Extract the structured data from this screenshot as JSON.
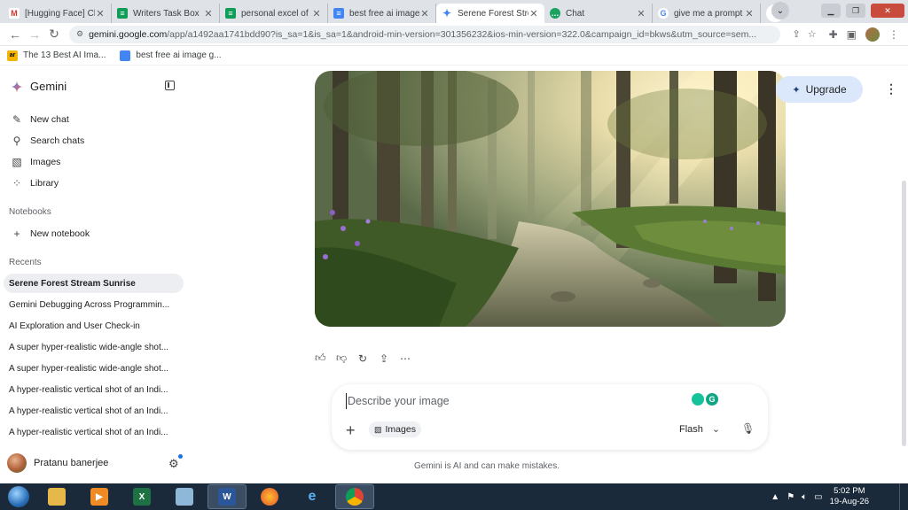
{
  "browser": {
    "tabs": [
      {
        "title": "[Hugging Face] Cl",
        "favicon": "gmail-icon",
        "active": false
      },
      {
        "title": "Writers Task Box",
        "favicon": "sheets-icon",
        "active": false
      },
      {
        "title": "personal excel of",
        "favicon": "sheets-icon",
        "active": false
      },
      {
        "title": "best free ai image",
        "favicon": "docs-icon",
        "active": false
      },
      {
        "title": "Serene Forest Stre",
        "favicon": "gemini-icon",
        "active": true
      },
      {
        "title": "Chat",
        "favicon": "chat-icon",
        "active": false
      },
      {
        "title": "give me a prompt",
        "favicon": "google-icon",
        "active": false
      }
    ],
    "url_host": "gemini.google.com",
    "url_rest": "/app/a1492aa1741bdd90?is_sa=1&is_sa=1&android-min-version=301356232&ios-min-version=322.0&campaign_id=bkws&utm_source=sem...",
    "bookmarks": [
      {
        "label": "The 13 Best AI Ima...",
        "icon_text": "ar"
      },
      {
        "label": "best free ai image g...",
        "icon_text": ""
      }
    ]
  },
  "sidebar": {
    "brand": "Gemini",
    "items": [
      {
        "label": "New chat",
        "icon": "edit-icon"
      },
      {
        "label": "Search chats",
        "icon": "search-icon"
      },
      {
        "label": "Images",
        "icon": "image-icon"
      },
      {
        "label": "Library",
        "icon": "library-icon"
      }
    ],
    "notebooks_label": "Notebooks",
    "new_notebook": "New notebook",
    "recents_label": "Recents",
    "recents": [
      "Serene Forest Stream Sunrise",
      "Gemini Debugging Across Programmin...",
      "AI Exploration and User Check-in",
      "A super hyper-realistic wide-angle shot...",
      "A super hyper-realistic wide-angle shot...",
      "A hyper-realistic vertical shot of an Indi...",
      "A hyper-realistic vertical shot of an Indi...",
      "A hyper-realistic vertical shot of an Indi..."
    ],
    "user_name": "Pratanu banerjee"
  },
  "main": {
    "upgrade_label": "Upgrade",
    "composer": {
      "placeholder": "Describe your image",
      "images_chip": "Images",
      "model": "Flash"
    },
    "disclaimer": "Gemini is AI and can make mistakes."
  },
  "taskbar": {
    "apps": [
      "explorer-icon",
      "media-player-icon",
      "excel-icon",
      "notepad-icon",
      "word-icon",
      "firefox-icon",
      "ie-icon",
      "chrome-icon"
    ],
    "time": "5:02 PM",
    "date": "19-Aug-26"
  },
  "colors": {
    "accent": "#1a73e8",
    "upgrade_bg": "#dbe8fb",
    "taskbar": "#1b2a3a"
  }
}
